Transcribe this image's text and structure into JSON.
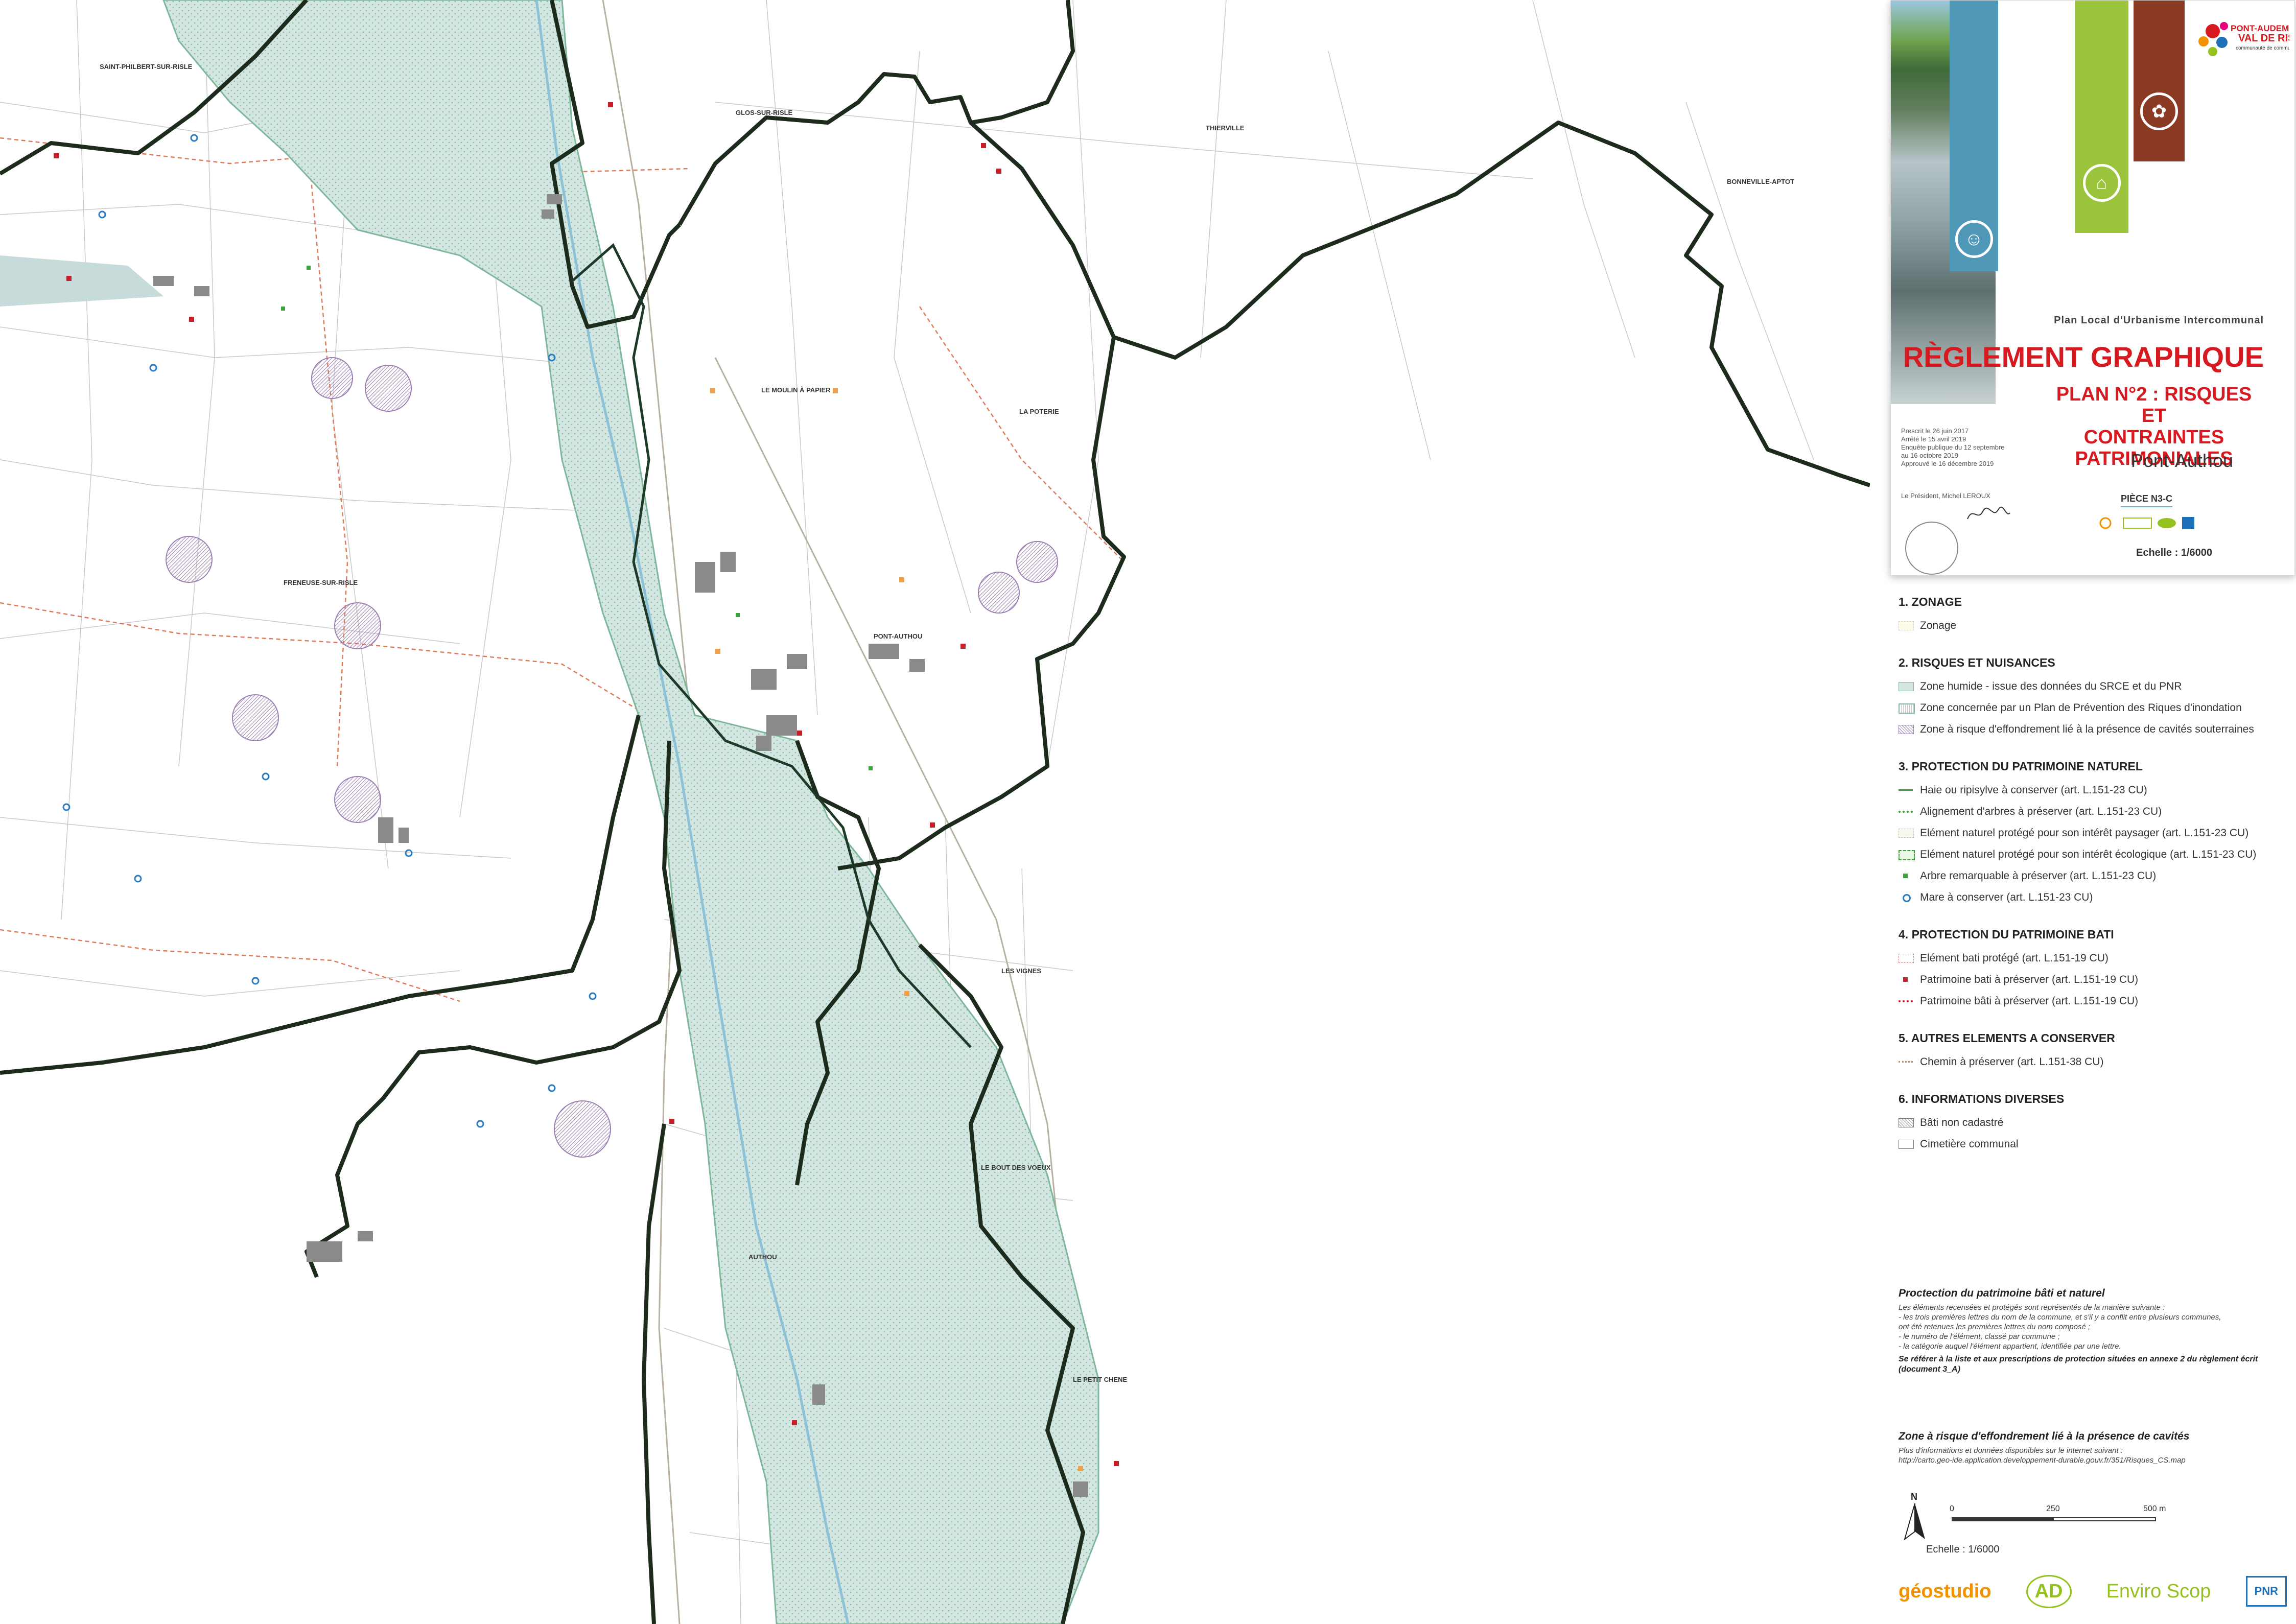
{
  "map": {
    "places": [
      "SAINT-PHILBERT-SUR-RISLE",
      "GLOS-SUR-RISLE",
      "THIERVILLE",
      "BONNEVILLE-APTOT",
      "LE MOULIN À PAPIER",
      "LA POTERIE",
      "FRENEUSE-SUR-RISLE",
      "PONT-AUTHOU",
      "LES VIGNES",
      "LE BOUT DES VOEUX",
      "AUTHOU",
      "LE PETIT CHENE"
    ],
    "colors": {
      "wetland": "#d3e6e2",
      "commune_boundary": "#1c2b1c",
      "cavity_zone": "#9c7fb2",
      "mare": "#2d7dc5",
      "patrimoine": "#c81e2a",
      "chemin": "#e07b5a"
    }
  },
  "cartouche": {
    "plan_type": "Plan Local d'Urbanisme Intercommunal",
    "title": "RÈGLEMENT GRAPHIQUE",
    "plan_line1": "PLAN N°2 : RISQUES ET",
    "plan_line2": "CONTRAINTES PATRIMONIALES",
    "commune": "Pont-Authou",
    "dates": [
      "Prescrit le 26 juin 2017",
      "Arrêté le 15 avril 2019",
      "Enquête publique du 12 septembre",
      "au 16 octobre 2019",
      "Approuvé le 16 décembre 2019"
    ],
    "president": "Le Président, Michel LEROUX",
    "piece": "PIÈCE N3-C",
    "echelle": "Echelle : 1/6000",
    "logo_name": "PONT-AUDEMER",
    "logo_name2": "VAL DE RISLE",
    "logo_sub": "communauté de communes"
  },
  "legend": [
    {
      "title": "1. ZONAGE",
      "items": [
        {
          "label": "Zonage",
          "symbol": "zonage"
        }
      ]
    },
    {
      "title": "2. RISQUES ET NUISANCES",
      "items": [
        {
          "label": "Zone humide - issue des données du SRCE et du PNR",
          "symbol": "wetland"
        },
        {
          "label": "Zone concernée par un Plan de Prévention des Riques d'inondation",
          "symbol": "ppri"
        },
        {
          "label": "Zone à risque d'effondrement lié à la présence de cavités souterraines",
          "symbol": "cavity"
        }
      ]
    },
    {
      "title": "3. PROTECTION DU PATRIMOINE NATUREL",
      "items": [
        {
          "label": "Haie ou ripisylve à conserver (art. L.151-23 CU)",
          "symbol": "hedge"
        },
        {
          "label": "Alignement d'arbres à préserver (art. L.151-23 CU)",
          "symbol": "trees"
        },
        {
          "label": "Elément naturel protégé pour son intérêt paysager (art. L.151-23 CU)",
          "symbol": "paysager"
        },
        {
          "label": "Elément naturel protégé pour son intérêt écologique (art. L.151-23 CU)",
          "symbol": "ecologique"
        },
        {
          "label": "Arbre remarquable à préserver (art. L.151-23 CU)",
          "symbol": "arbre"
        },
        {
          "label": "Mare à conserver (art. L.151-23 CU)",
          "symbol": "mare"
        }
      ]
    },
    {
      "title": "4. PROTECTION DU PATRIMOINE BATI",
      "items": [
        {
          "label": "Elément bati protégé (art. L.151-19 CU)",
          "symbol": "bati-protege"
        },
        {
          "label": "Patrimoine bati à préserver (art. L.151-19 CU)",
          "symbol": "bati-point"
        },
        {
          "label": "Patrimoine bâti à préserver (art. L.151-19 CU)",
          "symbol": "bati-line"
        }
      ]
    },
    {
      "title": "5. AUTRES ELEMENTS A CONSERVER",
      "items": [
        {
          "label": "Chemin à préserver  (art. L.151-38 CU)",
          "symbol": "chemin"
        }
      ]
    },
    {
      "title": "6. INFORMATIONS DIVERSES",
      "items": [
        {
          "label": "Bâti non cadastré",
          "symbol": "non-cadastre"
        },
        {
          "label": "Cimetière communal",
          "symbol": "cimetiere"
        }
      ]
    }
  ],
  "notes": {
    "heading": "Proctection du patrimoine bâti et naturel",
    "lines": [
      "Les éléments recensées et protégés sont représentés de la manière suivante :",
      "- les trois premières lettres du nom de la commune, et s'il y a conflit entre plusieurs communes,",
      "ont été retenues les premières lettres du nom composé ;",
      "- le numéro de l'élément, classé par commune ;",
      "- la catégorie auquel l'élément appartient, identifiée par une lettre."
    ],
    "bold": "Se référer à la liste et aux prescriptions de protection situées en annexe 2 du règlement écrit (document 3_A)",
    "heading2": "Zone à risque d'effondrement lié à la présence de cavités",
    "lines2": [
      "Plus d'informations et données disponibles sur le internet suivant :",
      "http://carto.geo-ide.application.developpement-durable.gouv.fr/351/Risques_CS.map"
    ]
  },
  "scale": {
    "north": "N",
    "ticks": [
      "0",
      "250",
      "500 m"
    ],
    "text": "Echelle : 1/6000"
  },
  "partners": [
    "géostudio",
    "AD",
    "Enviro Scop",
    "PNR"
  ]
}
